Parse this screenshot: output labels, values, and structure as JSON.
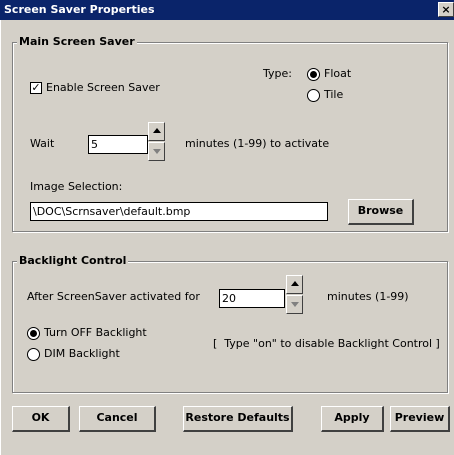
{
  "window": {
    "title": "Screen Saver Properties",
    "close_glyph": "×"
  },
  "main_group": {
    "label": "Main Screen Saver",
    "enable_label": "Enable Screen Saver",
    "enable_checked": true,
    "type_label": "Type:",
    "type_options": [
      {
        "label": "Float",
        "selected": true
      },
      {
        "label": "Tile",
        "selected": false
      }
    ],
    "wait_label": "Wait",
    "wait_value": "5",
    "wait_suffix": "minutes (1-99) to activate",
    "image_label": "Image Selection:",
    "image_path": "\\DOC\\Scrnsaver\\default.bmp",
    "browse_label": "Browse"
  },
  "backlight_group": {
    "label": "Backlight Control",
    "after_label": "After ScreenSaver activated for",
    "after_value": "20",
    "after_suffix": "minutes (1-99)",
    "options": [
      {
        "label": "Turn OFF Backlight",
        "selected": true
      },
      {
        "label": "DIM Backlight",
        "selected": false
      }
    ],
    "hint": "[  Type \"on\" to disable Backlight Control ]"
  },
  "buttons": {
    "ok": "OK",
    "cancel": "Cancel",
    "restore": "Restore Defaults",
    "apply": "Apply",
    "preview": "Preview"
  },
  "colors": {
    "titlebar": "#0a246a",
    "face": "#d4d0c8"
  }
}
